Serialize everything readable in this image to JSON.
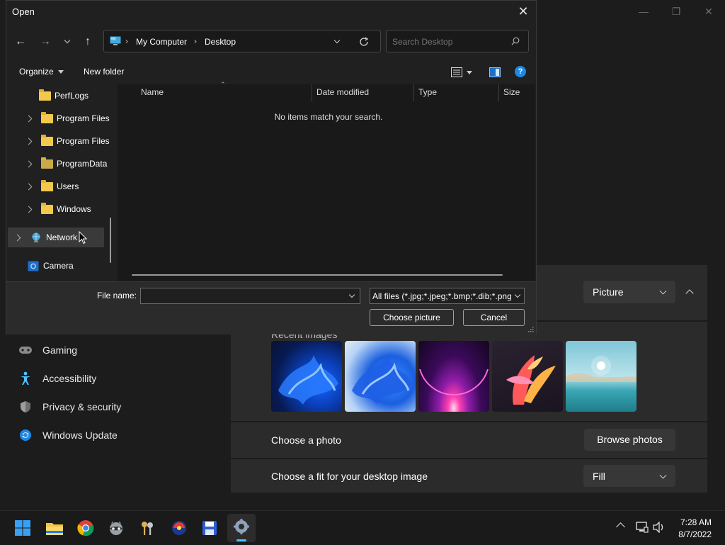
{
  "dialog": {
    "title": "Open",
    "address": {
      "root": "My Computer",
      "current": "Desktop"
    },
    "search_placeholder": "Search Desktop",
    "toolbar": {
      "organize": "Organize",
      "new_folder": "New folder"
    },
    "tree": [
      {
        "label": "PerfLogs",
        "expandable": false
      },
      {
        "label": "Program Files",
        "expandable": true
      },
      {
        "label": "Program Files",
        "expandable": true
      },
      {
        "label": "ProgramData",
        "expandable": true
      },
      {
        "label": "Users",
        "expandable": true
      },
      {
        "label": "Windows",
        "expandable": true
      },
      {
        "label": "Network",
        "expandable": true,
        "selected": true
      },
      {
        "label": "Camera",
        "expandable": false
      }
    ],
    "columns": [
      "Name",
      "Date modified",
      "Type",
      "Size"
    ],
    "empty_message": "No items match your search.",
    "file_name_label": "File name:",
    "file_name_value": "",
    "file_type": "All files (*.jpg;*.jpeg;*.bmp;*.dib;*.png",
    "choose_label": "Choose picture",
    "cancel_label": "Cancel"
  },
  "settings": {
    "nav": [
      "Gaming",
      "Accessibility",
      "Privacy & security",
      "Windows Update"
    ],
    "background_type": "Picture",
    "recent_images_label": "Recent images",
    "choose_photo_label": "Choose a photo",
    "browse_photos_label": "Browse photos",
    "fit_label": "Choose a fit for your desktop image",
    "fit_value": "Fill"
  },
  "taskbar": {
    "time": "7:28 AM",
    "date": "8/7/2022"
  },
  "colors": {
    "accent": "#0078d4",
    "folder": "#f2c94c"
  }
}
